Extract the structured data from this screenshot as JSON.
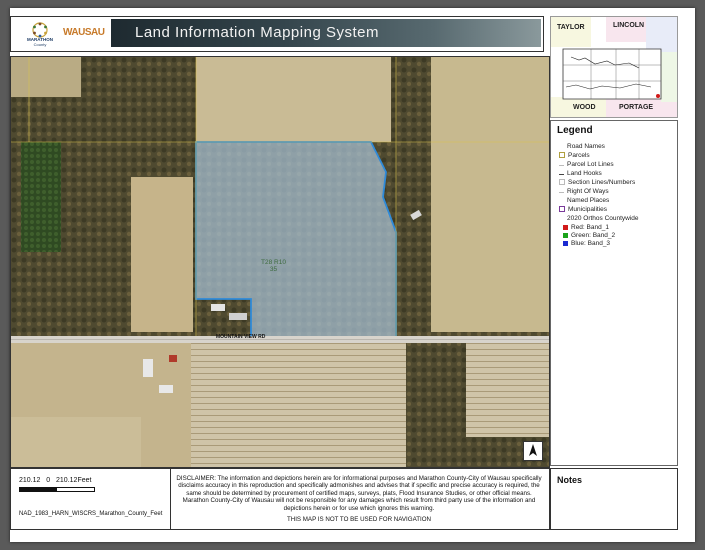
{
  "header": {
    "title": "Land Information Mapping System",
    "logo_marathon_top": "MARATHON",
    "logo_marathon_bottom": "County",
    "logo_wausau": "WAUSAU"
  },
  "map": {
    "parcel_label_line1": "T28 R10",
    "parcel_label_line2": "35",
    "road_label": "MOUNTAIN VIEW RD",
    "north_arrow": "north-arrow-icon"
  },
  "locator": {
    "towns": [
      "TAYLOR",
      "LINCOLN",
      "WOOD",
      "PORTAGE"
    ]
  },
  "legend": {
    "title": "Legend",
    "items": [
      "Road Names",
      "Parcels",
      "Parcel Lot Lines",
      "Land Hooks",
      "Section Lines/Numbers",
      "Right Of Ways",
      "Named Places",
      "Municipalities",
      "2020 Orthos Countywide"
    ],
    "bands": [
      {
        "label": "Red:",
        "value": "Band_1",
        "color": "#d11a1a"
      },
      {
        "label": "Green:",
        "value": "Band_2",
        "color": "#1aa31a"
      },
      {
        "label": "Blue:",
        "value": "Band_3",
        "color": "#1a2ad1"
      }
    ]
  },
  "scale": {
    "left": "210.12",
    "zero": "0",
    "right": "210.12",
    "unit": "Feet",
    "projection": "NAD_1983_HARN_WISCRS_Marathon_County_Feet"
  },
  "disclaimer": {
    "text": "DISCLAIMER: The information and depictions herein are for informational purposes and Marathon County-City of Wausau specifically disclaims accuracy in this reproduction and specifically admonishes and advises that if specific and precise accuracy is required, the same should be determined by procurement of certified maps, surveys, plats, Flood Insurance Studies, or other official means. Marathon County-City of Wausau will not be responsible for any damages which result from third party use of the information and depictions herein or for use which ignores this warning.",
    "warning": "THIS MAP IS NOT TO BE USED FOR NAVIGATION"
  },
  "notes": {
    "title": "Notes"
  }
}
